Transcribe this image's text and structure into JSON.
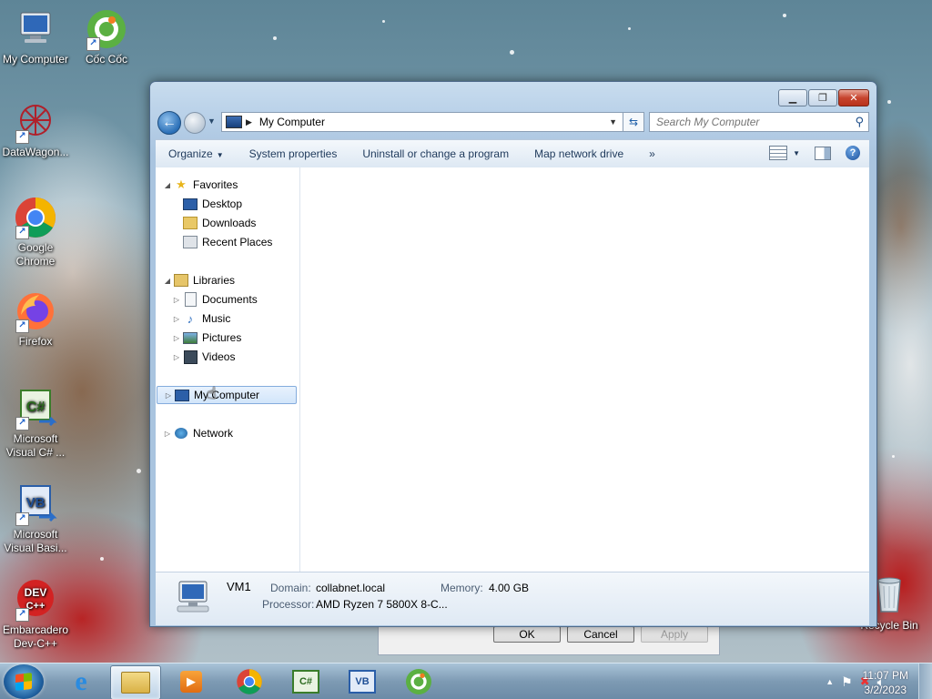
{
  "desktop": {
    "icons": [
      {
        "label": "My Computer"
      },
      {
        "label": "Cốc Cốc"
      },
      {
        "label": "DataWagon..."
      },
      {
        "label": "Google Chrome"
      },
      {
        "label": "Firefox"
      },
      {
        "label": "Microsoft Visual C# ..."
      },
      {
        "label": "Microsoft Visual Basi..."
      },
      {
        "label": "Embarcadero Dev-C++"
      },
      {
        "label": "Recycle Bin"
      }
    ]
  },
  "window": {
    "address": {
      "location": "My Computer"
    },
    "search": {
      "placeholder": "Search My Computer"
    },
    "toolbar": {
      "organize": "Organize",
      "system_properties": "System properties",
      "uninstall": "Uninstall or change a program",
      "map_drive": "Map network drive",
      "more": "»"
    },
    "nav": {
      "favorites": "Favorites",
      "desktop": "Desktop",
      "downloads": "Downloads",
      "recent_places": "Recent Places",
      "libraries": "Libraries",
      "documents": "Documents",
      "music": "Music",
      "pictures": "Pictures",
      "videos": "Videos",
      "my_computer": "My Computer",
      "network": "Network"
    },
    "details": {
      "name": "VM1",
      "domain_label": "Domain:",
      "domain_value": "collabnet.local",
      "memory_label": "Memory:",
      "memory_value": "4.00 GB",
      "processor_label": "Processor:",
      "processor_value": "AMD Ryzen 7 5800X 8-C..."
    }
  },
  "dialog_behind": {
    "ok": "OK",
    "cancel": "Cancel",
    "apply": "Apply"
  },
  "taskbar": {
    "time": "11:07 PM",
    "date": "3/2/2023"
  },
  "colors": {
    "accent": "#2a6fb7",
    "selection": "#d2e5fa",
    "close_button": "#c7442f"
  }
}
